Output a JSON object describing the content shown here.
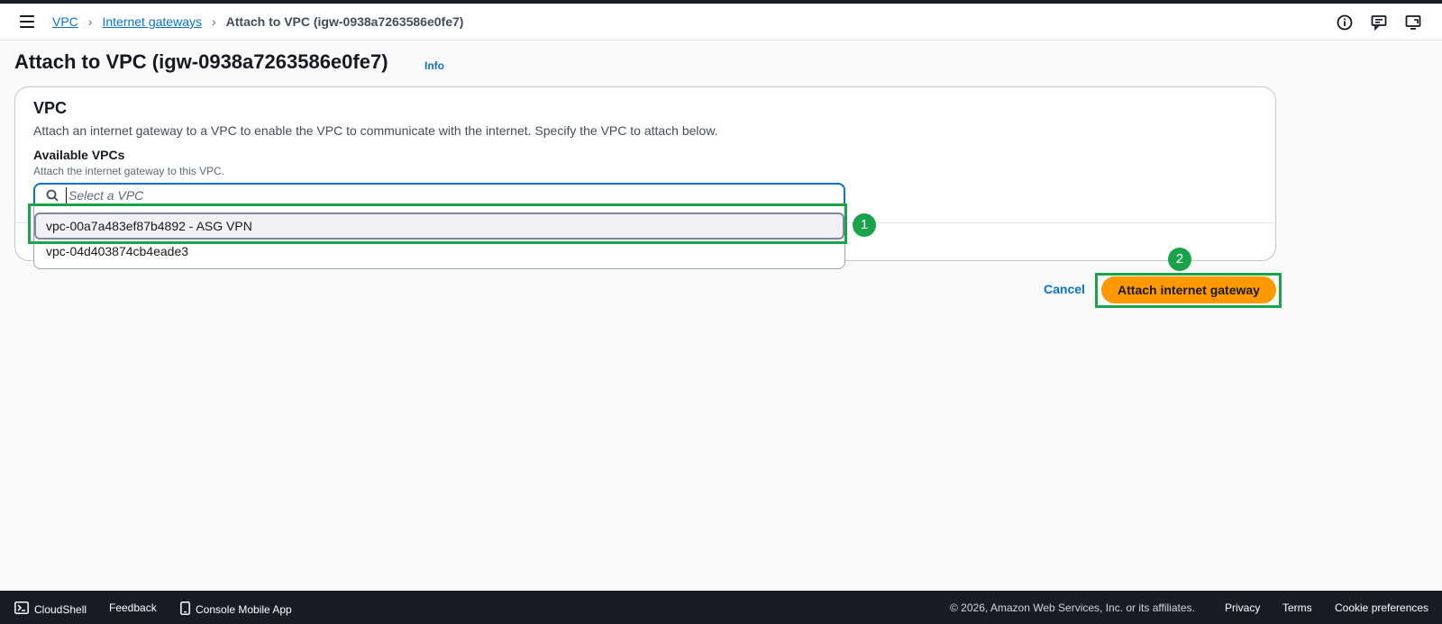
{
  "breadcrumb": {
    "items": [
      "VPC",
      "Internet gateways"
    ],
    "current": "Attach to VPC (igw-0938a7263586e0fe7)"
  },
  "header": {
    "title": "Attach to VPC (igw-0938a7263586e0fe7)",
    "info_label": "Info"
  },
  "panel": {
    "title": "VPC",
    "description": "Attach an internet gateway to a VPC to enable the VPC to communicate with the internet. Specify the VPC to attach below.",
    "field_label": "Available VPCs",
    "field_hint": "Attach the internet gateway to this VPC.",
    "search_placeholder": "Select a VPC",
    "options": [
      "vpc-00a7a483ef87b4892 - ASG VPN",
      "vpc-04d403874cb4eade3"
    ]
  },
  "actions": {
    "cancel_label": "Cancel",
    "attach_label": "Attach internet gateway"
  },
  "annotations": [
    "1",
    "2"
  ],
  "footer": {
    "cloudshell": "CloudShell",
    "feedback": "Feedback",
    "mobile_app": "Console Mobile App",
    "copyright": "© 2026, Amazon Web Services, Inc. or its affiliates.",
    "privacy": "Privacy",
    "terms": "Terms",
    "cookies": "Cookie preferences"
  },
  "icons": [
    "menu-icon",
    "chevron-right-icon",
    "info-circle-icon",
    "feedback-icon",
    "display-icon",
    "search-icon",
    "cloudshell-icon",
    "mobile-icon"
  ],
  "colors": {
    "link": "#0972d3",
    "primary_button": "#ff9900",
    "annotation": "#1aa34a",
    "footer_bg": "#161d26"
  }
}
